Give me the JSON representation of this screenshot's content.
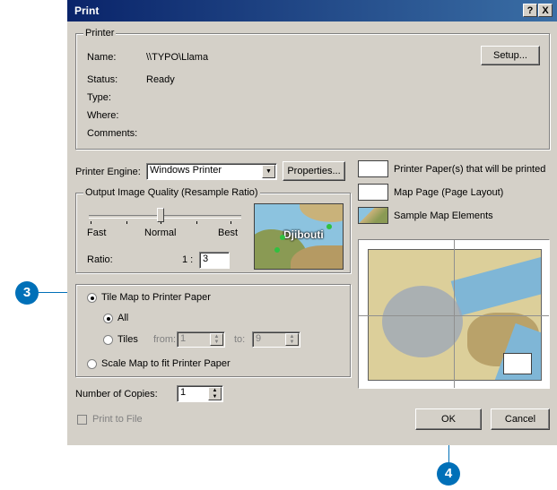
{
  "window": {
    "title": "Print",
    "help_icon_label": "?",
    "close_icon_label": "X"
  },
  "printer": {
    "group_label": "Printer",
    "name_label": "Name:",
    "name_value": "\\\\TYPO\\Llama",
    "status_label": "Status:",
    "status_value": "Ready",
    "type_label": "Type:",
    "where_label": "Where:",
    "comments_label": "Comments:",
    "setup_button": "Setup..."
  },
  "engine": {
    "label": "Printer Engine:",
    "value": "Windows Printer",
    "properties_button": "Properties..."
  },
  "quality": {
    "group_label": "Output Image Quality (Resample Ratio)",
    "fast": "Fast",
    "normal": "Normal",
    "best": "Best",
    "slider_level": "normal",
    "ratio_label": "Ratio:",
    "ratio_prefix": "1 :",
    "ratio_value": "3",
    "preview_label": "Djibouti"
  },
  "legend": {
    "paper": "Printer Paper(s) that will be printed",
    "map_page": "Map Page (Page Layout)",
    "sample": "Sample Map Elements"
  },
  "tiling": {
    "tile_option": "Tile Map to Printer Paper",
    "all_option": "All",
    "tiles_option": "Tiles",
    "from_label": "from:",
    "from_value": "1",
    "to_label": "to:",
    "to_value": "9",
    "scale_option": "Scale Map to fit Printer Paper",
    "selected": "tile"
  },
  "copies": {
    "label": "Number of Copies:",
    "value": "1"
  },
  "print_to_file": "Print to File",
  "buttons": {
    "ok": "OK",
    "cancel": "Cancel"
  },
  "callouts": {
    "step3": "3",
    "step4": "4"
  },
  "colors": {
    "dialog_bg": "#d4d0c8",
    "title_start": "#0a246a",
    "title_end": "#3a6ea5",
    "callout": "#0070b8"
  }
}
